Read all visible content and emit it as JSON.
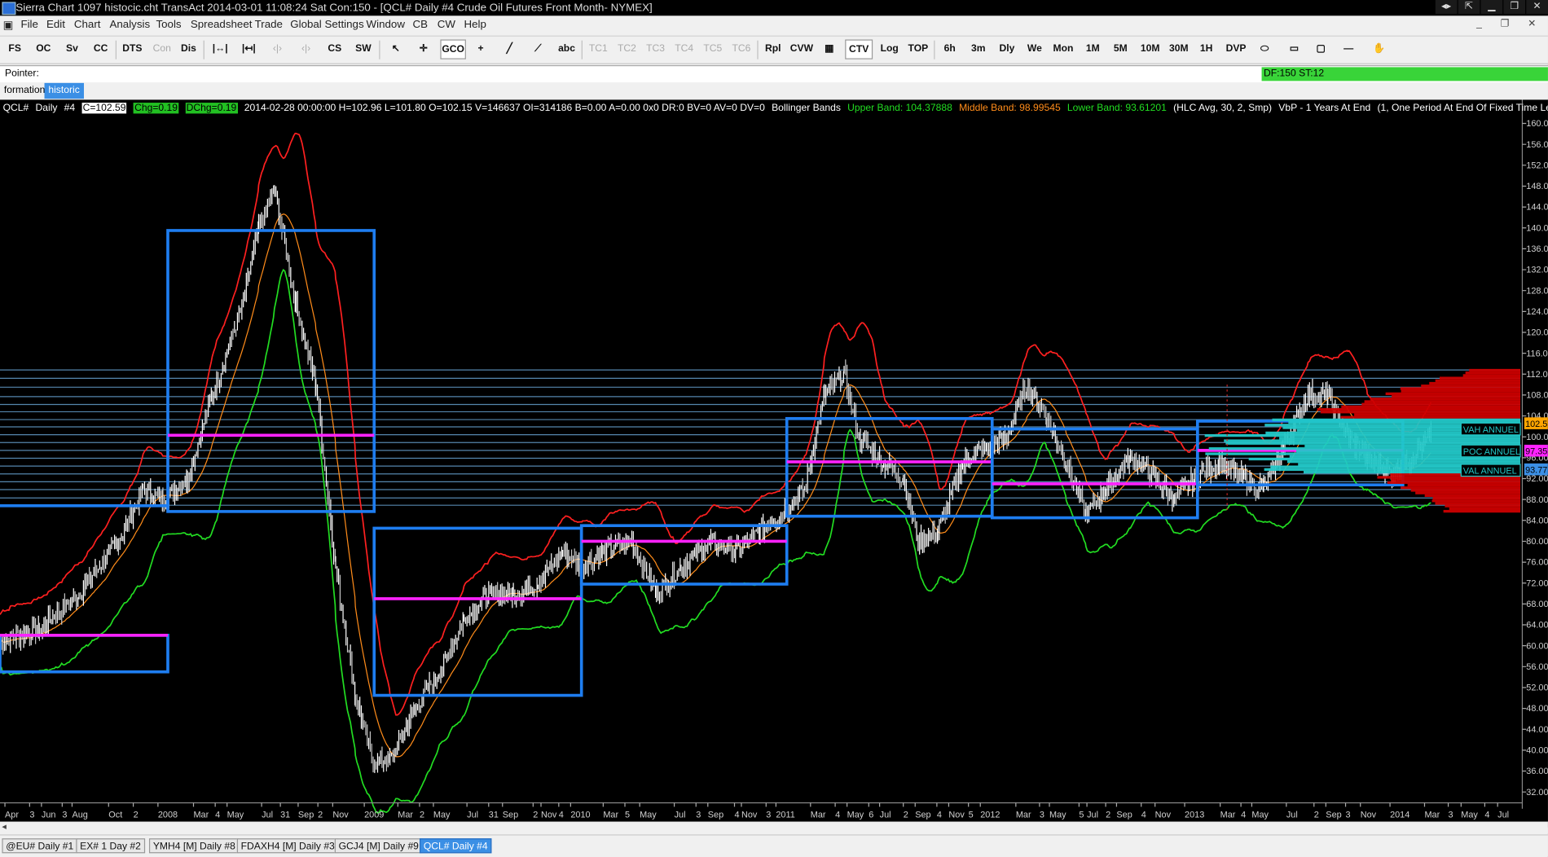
{
  "window": {
    "title": "Sierra Chart 1097 histocic.cht  TransAct 2014-03-01  11:08:24 Sat  Con:150 - [QCL#  Daily  #4  Crude Oil Futures Front Month- NYMEX]"
  },
  "menu": [
    "File",
    "Edit",
    "Chart",
    "Analysis",
    "Tools",
    "Spreadsheet",
    "Trade",
    "Global Settings",
    "Window",
    "CB",
    "CW",
    "Help"
  ],
  "toolbar": {
    "buttons": [
      "FS",
      "OC",
      "Sv",
      "CC",
      "DTS",
      "Con",
      "Dis",
      "CS",
      "SW",
      "GCO",
      "abc",
      "TC1",
      "TC2",
      "TC3",
      "TC4",
      "TC5",
      "TC6",
      "Rpl",
      "CVW",
      "CTV",
      "Log",
      "TOP",
      "6h",
      "3m",
      "Dly",
      "We",
      "Mon",
      "1M",
      "5M",
      "10M",
      "30M",
      "1H",
      "DVP"
    ]
  },
  "pointer": {
    "label": "Pointer:",
    "status": "DF:150  ST:12"
  },
  "chartbook_tabs": [
    "formation",
    "historic"
  ],
  "chart": {
    "symbol": "QCL#",
    "period": "Daily",
    "chart_num": "#4",
    "close": "C=102.59",
    "chg": "Chg=0.19",
    "dchg": "DChg=0.19",
    "bar_info": "2014-02-28 00:00:00 H=102.96 L=101.80 O=102.15 V=146637 OI=314186 B=0.00 A=0.00 0x0 DR:0 BV=0 AV=0 DV=0",
    "study_name": "Bollinger Bands",
    "upper_band": "Upper Band: 104.37888",
    "middle_band": "Middle Band: 98.99545",
    "lower_band": "Lower Band: 93.61201",
    "study_params": "(HLC Avg, 30, 2, Smp)",
    "vbp": "VbP - 1 Years At End",
    "vbp_params": "(1, One Period At End Of Fixed Time Length, Years, 1, 90, , No",
    "price_labels": [
      "160.00",
      "156.00",
      "152.00",
      "148.00",
      "144.00",
      "140.00",
      "136.00",
      "132.00",
      "128.00",
      "124.00",
      "120.00",
      "116.00",
      "112.00",
      "108.00",
      "104.00",
      "100.00",
      "96.00",
      "92.00",
      "88.00",
      "84.00",
      "80.00",
      "76.00",
      "72.00",
      "68.00",
      "64.00",
      "60.00",
      "56.00",
      "52.00",
      "48.00",
      "44.00",
      "40.00",
      "36.00",
      "32.00"
    ],
    "last_price_tag": "102.59",
    "poc_tag": "97.35",
    "val_tag": "93.77",
    "vah_label": "VAH ANNUEL",
    "poc_label": "POC ANNUEL",
    "val_label": "VAL ANNUEL",
    "time_labels": [
      "Apr",
      "3",
      "Jun",
      "3",
      "Aug",
      "Oct",
      "2",
      "2008",
      "Mar",
      "4",
      "May",
      "Jul",
      "31",
      "Sep",
      "2",
      "Nov",
      "2009",
      "Mar",
      "2",
      "May",
      "Jul",
      "31",
      "Sep",
      "2",
      "Nov",
      "4",
      "2010",
      "Mar",
      "5",
      "May",
      "Jul",
      "3",
      "Sep",
      "4",
      "Nov",
      "3",
      "2011",
      "Mar",
      "4",
      "May",
      "6",
      "Jul",
      "2",
      "Sep",
      "4",
      "Nov",
      "5",
      "2012",
      "Mar",
      "3",
      "May",
      "5",
      "Jul",
      "2",
      "Sep",
      "4",
      "Nov",
      "2013",
      "Mar",
      "4",
      "May",
      "Jul",
      "2",
      "Sep",
      "3",
      "Nov",
      "2014",
      "Mar",
      "3",
      "May",
      "4",
      "Jul"
    ],
    "colors": {
      "background": "#000000",
      "upper_band": "#ff2020",
      "middle_band": "#ff8c1a",
      "lower_band": "#22dd22",
      "boxes": "#1e7df0",
      "poc_lines": "#ff22ff",
      "profile_high": "#cc0000",
      "profile_value_area": "#22c8c8"
    },
    "yearly_boxes": [
      {
        "period": "2007",
        "high": 62,
        "low": 55,
        "poc": 62
      },
      {
        "period": "2008",
        "high": 139.5,
        "low": 85.7,
        "poc": 100.3
      },
      {
        "period": "2009",
        "high": 82.5,
        "low": 50.5,
        "poc": 69
      },
      {
        "period": "2010",
        "high": 83,
        "low": 71.8,
        "poc": 80
      },
      {
        "period": "2011",
        "high": 103.5,
        "low": 84.8,
        "poc": 95.2
      },
      {
        "period": "2012",
        "high": 101.5,
        "low": 84.5,
        "poc": 91
      },
      {
        "period": "2013",
        "high": 103,
        "low": 90.8,
        "poc": 97.4
      }
    ]
  },
  "sheet_tabs": [
    "@EU#  Daily  #1",
    "EX#  1 Day  #2",
    "YMH4 [M]  Daily  #8",
    "FDAXH4 [M]  Daily  #3",
    "GCJ4 [M]  Daily  #9",
    "QCL#  Daily  #4"
  ]
}
